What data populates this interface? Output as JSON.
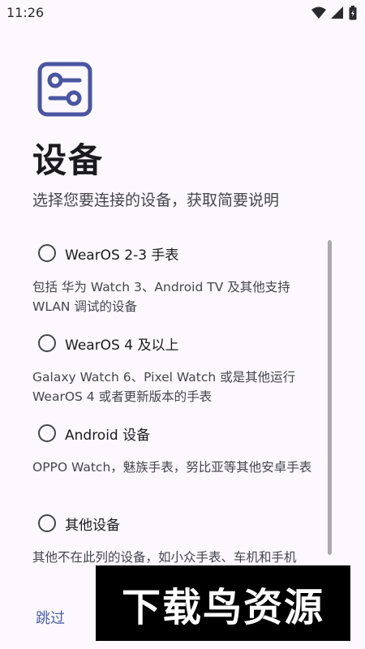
{
  "status_bar": {
    "time": "11:26",
    "icons": [
      "wifi-icon",
      "signal-icon",
      "battery-icon"
    ]
  },
  "header": {
    "app_icon": "settings-sliders-icon",
    "title": "设备",
    "subtitle": "选择您要连接的设备，获取简要说明"
  },
  "options": [
    {
      "label": "WearOS 2-3 手表",
      "description": "包括 华为 Watch 3、Android TV 及其他支持 WLAN 调试的设备",
      "selected": false
    },
    {
      "label": "WearOS 4 及以上",
      "description": "Galaxy Watch 6、Pixel Watch 或是其他运行 WearOS 4 或者更新版本的手表",
      "selected": false
    },
    {
      "label": "Android 设备",
      "description": "OPPO Watch，魅族手表，努比亚等其他安卓手表",
      "selected": false
    },
    {
      "label": "其他设备",
      "description": "其他不在此列的设备，如小众手表、车机和手机",
      "selected": false
    }
  ],
  "footer": {
    "skip_label": "跳过"
  },
  "watermark": {
    "text": "下载鸟资源"
  },
  "colors": {
    "background": "#fcf8fd",
    "primary": "#4b5fa8",
    "icon_accent": "#4a55a2"
  }
}
